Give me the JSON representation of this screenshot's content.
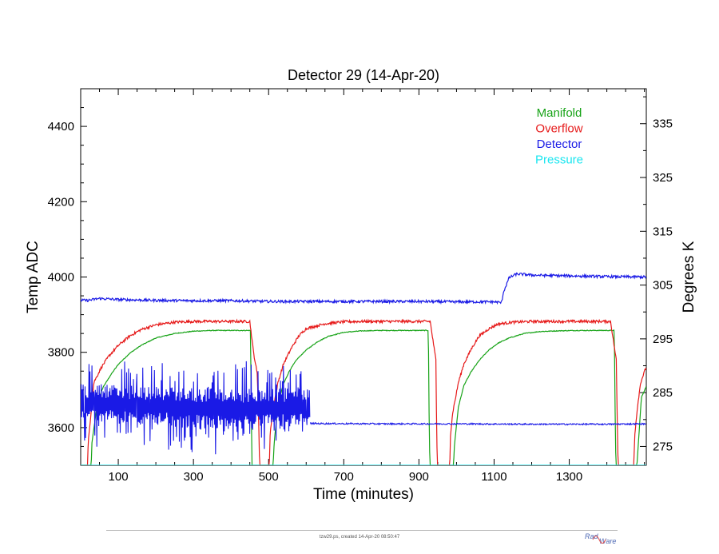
{
  "chart_data": {
    "type": "line",
    "title": "Detector 29 (14-Apr-20)",
    "xlabel": "Time (minutes)",
    "ylabel": "Temp ADC",
    "y2label": "Degrees K",
    "xlim": [
      0,
      1505
    ],
    "ylim": [
      3500,
      4500
    ],
    "y2lim": [
      271.5,
      341.5
    ],
    "xticks": [
      100,
      300,
      500,
      700,
      900,
      1100,
      1300
    ],
    "yticks": [
      3600,
      3800,
      4000,
      4200,
      4400
    ],
    "y2ticks": [
      275,
      285,
      295,
      305,
      315,
      325,
      335
    ],
    "legend_position": "top-right",
    "grid": false,
    "series": [
      {
        "name": "Manifold",
        "color": "#17a317",
        "axis": "left",
        "x": [
          0,
          25,
          28,
          30,
          45,
          60,
          80,
          100,
          130,
          160,
          200,
          250,
          300,
          350,
          400,
          452,
          454,
          456,
          500,
          512,
          515,
          525,
          540,
          555,
          575,
          600,
          630,
          660,
          700,
          750,
          800,
          850,
          900,
          925,
          927,
          929,
          975,
          992,
          995,
          1005,
          1020,
          1040,
          1060,
          1085,
          1110,
          1140,
          1180,
          1220,
          1270,
          1320,
          1370,
          1420,
          1422,
          1424,
          1470,
          1480,
          1492,
          1505
        ],
        "y": [
          3500,
          3500,
          3500,
          3560,
          3668,
          3708,
          3740,
          3768,
          3797,
          3818,
          3838,
          3850,
          3856,
          3858,
          3858,
          3858,
          3640,
          3500,
          3500,
          3500,
          3560,
          3664,
          3717,
          3750,
          3781,
          3806,
          3828,
          3843,
          3853,
          3857,
          3858,
          3858,
          3858,
          3858,
          3640,
          3500,
          3500,
          3500,
          3560,
          3655,
          3713,
          3750,
          3778,
          3805,
          3824,
          3838,
          3850,
          3855,
          3857,
          3858,
          3858,
          3858,
          3640,
          3500,
          3500,
          3500,
          3680,
          3710
        ]
      },
      {
        "name": "Overflow",
        "color": "#e61919",
        "axis": "left",
        "x": [
          0,
          15,
          18,
          20,
          35,
          55,
          75,
          100,
          130,
          160,
          200,
          250,
          300,
          350,
          400,
          450,
          460,
          470,
          474,
          476,
          500,
          502,
          504,
          510,
          525,
          540,
          560,
          580,
          600,
          650,
          700,
          750,
          800,
          850,
          900,
          930,
          945,
          947,
          949,
          980,
          982,
          984,
          990,
          1005,
          1020,
          1040,
          1060,
          1085,
          1110,
          1150,
          1200,
          1250,
          1300,
          1350,
          1400,
          1410,
          1425,
          1428,
          1430,
          1470,
          1472,
          1474,
          1482,
          1490,
          1505
        ],
        "y": [
          3500,
          3500,
          3500,
          3560,
          3720,
          3760,
          3790,
          3818,
          3843,
          3860,
          3873,
          3880,
          3882,
          3882,
          3882,
          3882,
          3800,
          3740,
          3600,
          3500,
          3500,
          3500,
          3580,
          3640,
          3720,
          3770,
          3810,
          3843,
          3863,
          3876,
          3881,
          3882,
          3882,
          3882,
          3882,
          3882,
          3780,
          3600,
          3500,
          3500,
          3500,
          3580,
          3640,
          3720,
          3770,
          3810,
          3843,
          3862,
          3875,
          3880,
          3882,
          3882,
          3882,
          3882,
          3882,
          3882,
          3780,
          3600,
          3500,
          3500,
          3500,
          3580,
          3660,
          3720,
          3762
        ]
      },
      {
        "name": "Detector",
        "color": "#1a1ae6",
        "axis": "left",
        "x": [
          0,
          20,
          50,
          100,
          200,
          300,
          400,
          500,
          600,
          700,
          800,
          900,
          1000,
          1100,
          1120,
          1125,
          1140,
          1160,
          1180,
          1200,
          1300,
          1400,
          1505
        ],
        "y": [
          3938,
          3938,
          3943,
          3940,
          3938,
          3937,
          3937,
          3935,
          3935,
          3935,
          3935,
          3935,
          3934,
          3934,
          3932,
          3960,
          3998,
          4008,
          4007,
          4005,
          4003,
          4001,
          4000
        ],
        "segments": [
          {
            "x": [
              0,
              140,
              320,
              420,
              540,
              610
            ],
            "y": [
              3662,
              3655,
              3650,
              3648,
              3650,
              3655
            ],
            "oscillation": "spikes"
          },
          {
            "x": [
              610,
              800,
              1000,
              1200,
              1400,
              1505
            ],
            "y": [
              3611,
              3610,
              3610,
              3609,
              3609,
              3610
            ]
          }
        ]
      },
      {
        "name": "Pressure",
        "color": "#1ae6f0",
        "axis": "left",
        "x": [
          0,
          1505
        ],
        "y": [
          3500,
          3500
        ]
      }
    ]
  },
  "footer": {
    "caption": "tzw29.ps, created 14-Apr-20 08:50:47",
    "logo_part1": "Rad",
    "logo_part2": "Ware"
  }
}
